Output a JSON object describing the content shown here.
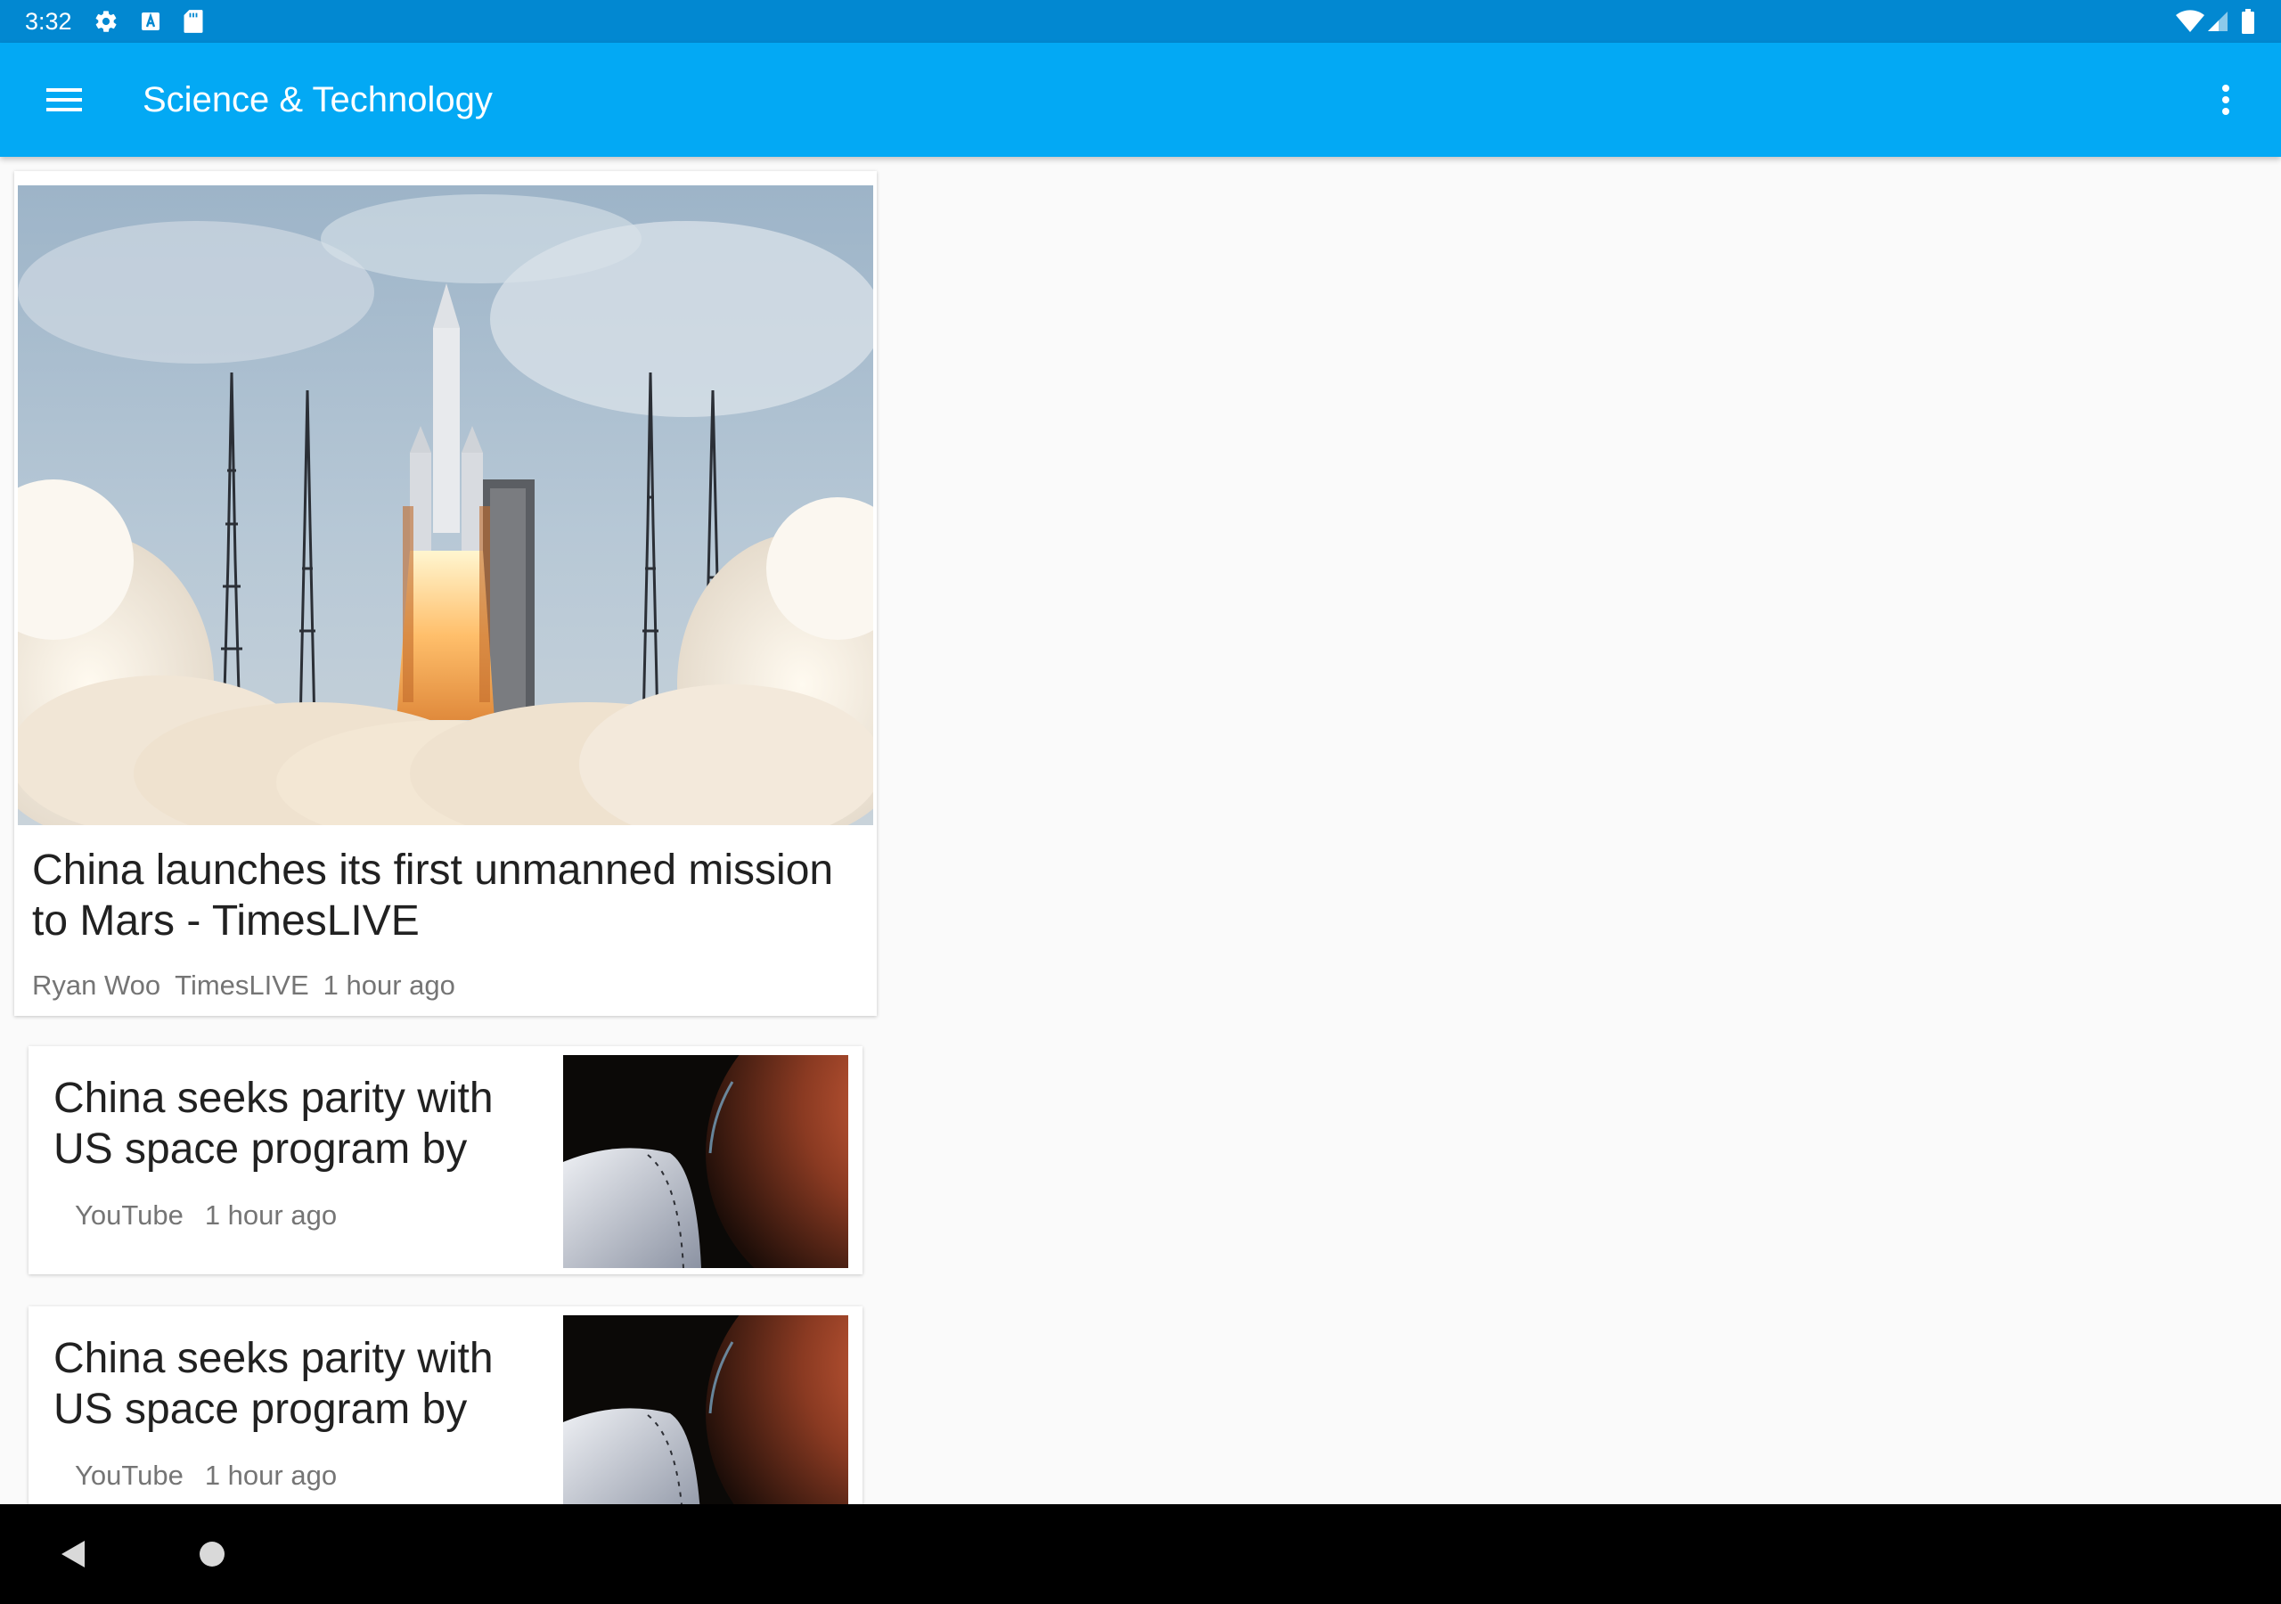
{
  "status_bar": {
    "time": "3:32",
    "icons": [
      "gear-icon",
      "text-box-icon",
      "sd-card-icon",
      "wifi-icon",
      "cell-signal-icon",
      "battery-icon"
    ],
    "background": "#0288d1"
  },
  "app_bar": {
    "title": "Science & Technology",
    "menu_icon": "hamburger-menu-icon",
    "overflow_icon": "more-vert-icon",
    "background": "#03a9f4"
  },
  "articles": [
    {
      "title": "China launches its first unmanned mission to Mars - TimesLIVE",
      "author": "Ryan Woo",
      "source": "TimesLIVE",
      "time": "1 hour ago",
      "image": "rocket-launch-photo"
    },
    {
      "title": "China seeks parity with US space program by",
      "author": "",
      "source": "YouTube",
      "time": "1 hour ago",
      "image": "mars-spacecraft-thumbnail"
    },
    {
      "title": "China seeks parity with US space program by",
      "author": "",
      "source": "YouTube",
      "time": "1 hour ago",
      "image": "mars-spacecraft-thumbnail"
    }
  ],
  "nav_bar": {
    "icons": [
      "back-icon",
      "home-icon"
    ]
  }
}
